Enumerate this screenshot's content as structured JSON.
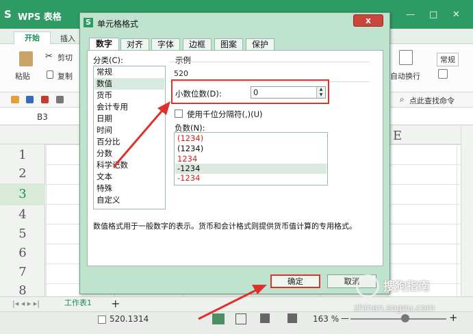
{
  "app": {
    "logo": "S",
    "name": "WPS 表格"
  },
  "window_controls": {
    "minimize": "—",
    "maximize": "□",
    "close": "✕"
  },
  "ribbon": {
    "tabs": [
      "开始",
      "插入"
    ],
    "paste_label": "粘贴",
    "cut_label": "剪切",
    "copy_label": "复制",
    "wrap_label": "自动换行",
    "format_label": "常规",
    "find_label": "点此查找命令"
  },
  "cell_ref": "B3",
  "column_header": "E",
  "rows": [
    "1",
    "2",
    "3",
    "4",
    "5",
    "6",
    "7",
    "8"
  ],
  "sheet_tab": "工作表1",
  "sheet_add": "+",
  "status": {
    "value": "520.1314",
    "zoom": "163 %",
    "zoom_minus": "—",
    "zoom_plus": "+"
  },
  "dialog": {
    "icon": "S",
    "title": "单元格格式",
    "close": "x",
    "tabs": [
      "数字",
      "对齐",
      "字体",
      "边框",
      "图案",
      "保护"
    ],
    "category_label": "分类(C):",
    "categories": [
      "常规",
      "数值",
      "货币",
      "会计专用",
      "日期",
      "时间",
      "百分比",
      "分数",
      "科学记数",
      "文本",
      "特殊",
      "自定义"
    ],
    "selected_category": "数值",
    "sample_label": "示例",
    "sample_value": "520",
    "decimals_label": "小数位数(D):",
    "decimals_value": "0",
    "thousands_label": "使用千位分隔符(,)(U)",
    "thousands_checked": false,
    "negative_label": "负数(N):",
    "negatives": [
      {
        "text": "(1234)",
        "color": "#d42020"
      },
      {
        "text": "(1234)",
        "color": "#111111"
      },
      {
        "text": "1234",
        "color": "#d42020"
      },
      {
        "text": "-1234",
        "color": "#111111"
      },
      {
        "text": "-1234",
        "color": "#d42020"
      }
    ],
    "selected_negative": "-1234",
    "description": "数值格式用于一般数字的表示。货币和会计格式则提供货币值计算的专用格式。",
    "ok_label": "确定",
    "cancel_label": "取消"
  },
  "watermark": {
    "text": "搜狗指南",
    "url": "zhinan.sogou.com"
  }
}
